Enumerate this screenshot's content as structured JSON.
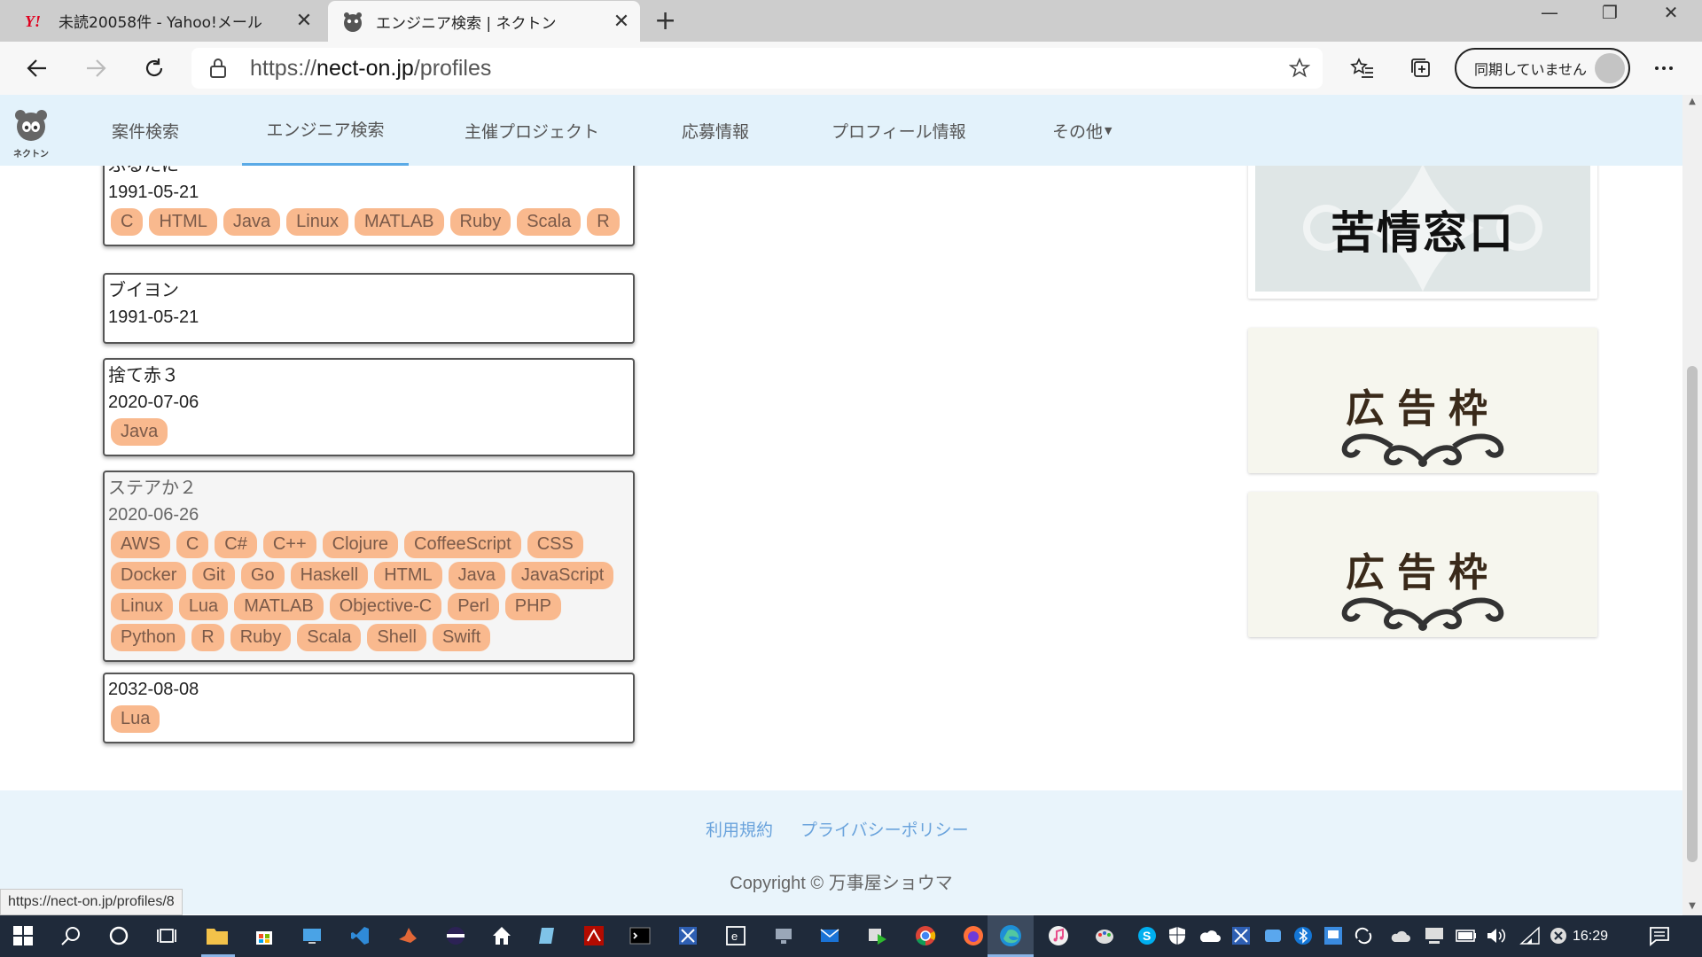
{
  "browser": {
    "tabs": [
      {
        "title": "未読20058件 - Yahoo!メール",
        "favicon": "yahoo-icon",
        "active": false
      },
      {
        "title": "エンジニア検索 | ネクトン",
        "favicon": "nekuton-icon",
        "active": true
      }
    ],
    "url_scheme": "https://",
    "url_host": "nect-on.jp",
    "url_path": "/profiles",
    "sync_label": "同期していません"
  },
  "site": {
    "logo_text": "ネクトン",
    "nav": [
      {
        "label": "案件検索",
        "active": false
      },
      {
        "label": "エンジニア検索",
        "active": true
      },
      {
        "label": "主催プロジェクト",
        "active": false
      },
      {
        "label": "応募情報",
        "active": false
      },
      {
        "label": "プロフィール情報",
        "active": false
      },
      {
        "label": "その他",
        "active": false,
        "dropdown": true
      }
    ]
  },
  "profiles": [
    {
      "name": "ふるたに",
      "date": "1991-05-21",
      "tags": [
        "C",
        "HTML",
        "Java",
        "Linux",
        "MATLAB",
        "Ruby",
        "Scala",
        "R"
      ]
    },
    {
      "name": "ブイヨン",
      "date": "1991-05-21",
      "tags": []
    },
    {
      "name": "捨て赤３",
      "date": "2020-07-06",
      "tags": [
        "Java"
      ]
    },
    {
      "name": "ステアか２",
      "date": "2020-06-26",
      "tags": [
        "AWS",
        "C",
        "C#",
        "C++",
        "Clojure",
        "CoffeeScript",
        "CSS",
        "Docker",
        "Git",
        "Go",
        "Haskell",
        "HTML",
        "Java",
        "JavaScript",
        "Linux",
        "Lua",
        "MATLAB",
        "Objective-C",
        "Perl",
        "PHP",
        "Python",
        "R",
        "Ruby",
        "Scala",
        "Shell",
        "Swift"
      ],
      "hover": true
    },
    {
      "name": "",
      "date": "2032-08-08",
      "tags": [
        "Lua"
      ]
    }
  ],
  "ads": {
    "complaint": "苦情窓口",
    "ad_slot_1": "広告枠",
    "ad_slot_2": "広告枠"
  },
  "footer": {
    "terms": "利用規約",
    "privacy": "プライバシーポリシー",
    "copyright": "Copyright © 万事屋ショウマ"
  },
  "status_url": "https://nect-on.jp/profiles/8",
  "taskbar": {
    "time": "16:29"
  },
  "colors": {
    "tag_bg": "#f9b98e",
    "header_bg": "#e3f2fb",
    "active_underline": "#5aaae6",
    "footer_link": "#6aa3dc"
  }
}
